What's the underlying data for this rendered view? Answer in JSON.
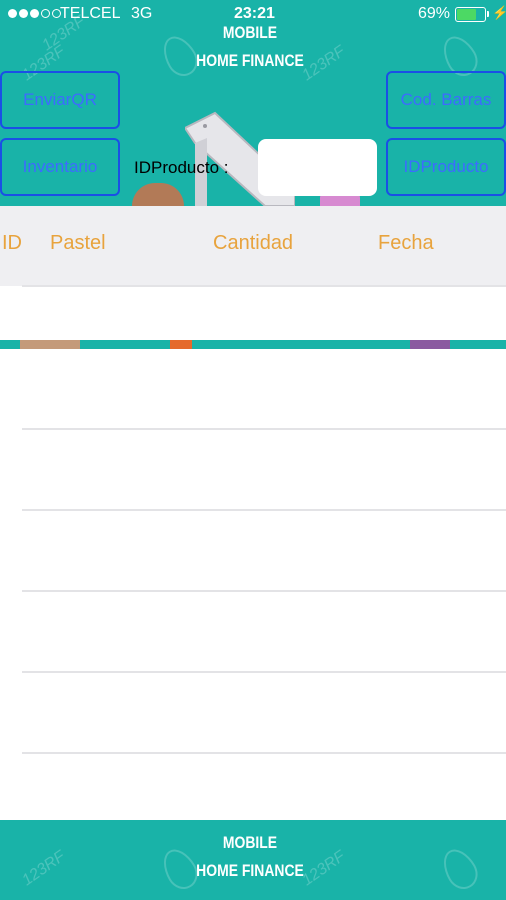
{
  "status_bar": {
    "carrier": "TELCEL",
    "network": "3G",
    "time": "23:21",
    "battery_percent": "69%",
    "battery_level": 0.69,
    "signal_bars_filled": 3,
    "signal_bars_total": 5
  },
  "header": {
    "brand_line1": "MOBILE",
    "brand_line2": "HOME FINANCE",
    "watermark_text": "123RF"
  },
  "buttons": {
    "enviar_qr": "EnviarQR",
    "inventario": "Inventario",
    "cod_barras": "Cod. Barras",
    "id_producto": "IDProducto"
  },
  "search": {
    "label": "IDProducto :",
    "value": ""
  },
  "table": {
    "columns": [
      "ID",
      "Pastel",
      "Cantidad",
      "Fecha"
    ],
    "rows": []
  },
  "footer": {
    "brand_line1": "MOBILE",
    "brand_line2": "HOME FINANCE"
  },
  "colors": {
    "accent": "#19b3a8",
    "button_border": "#1a4fe6",
    "button_text": "#3d6bff",
    "column_header_text": "#e8a33d",
    "battery_fill": "#4cd964"
  }
}
